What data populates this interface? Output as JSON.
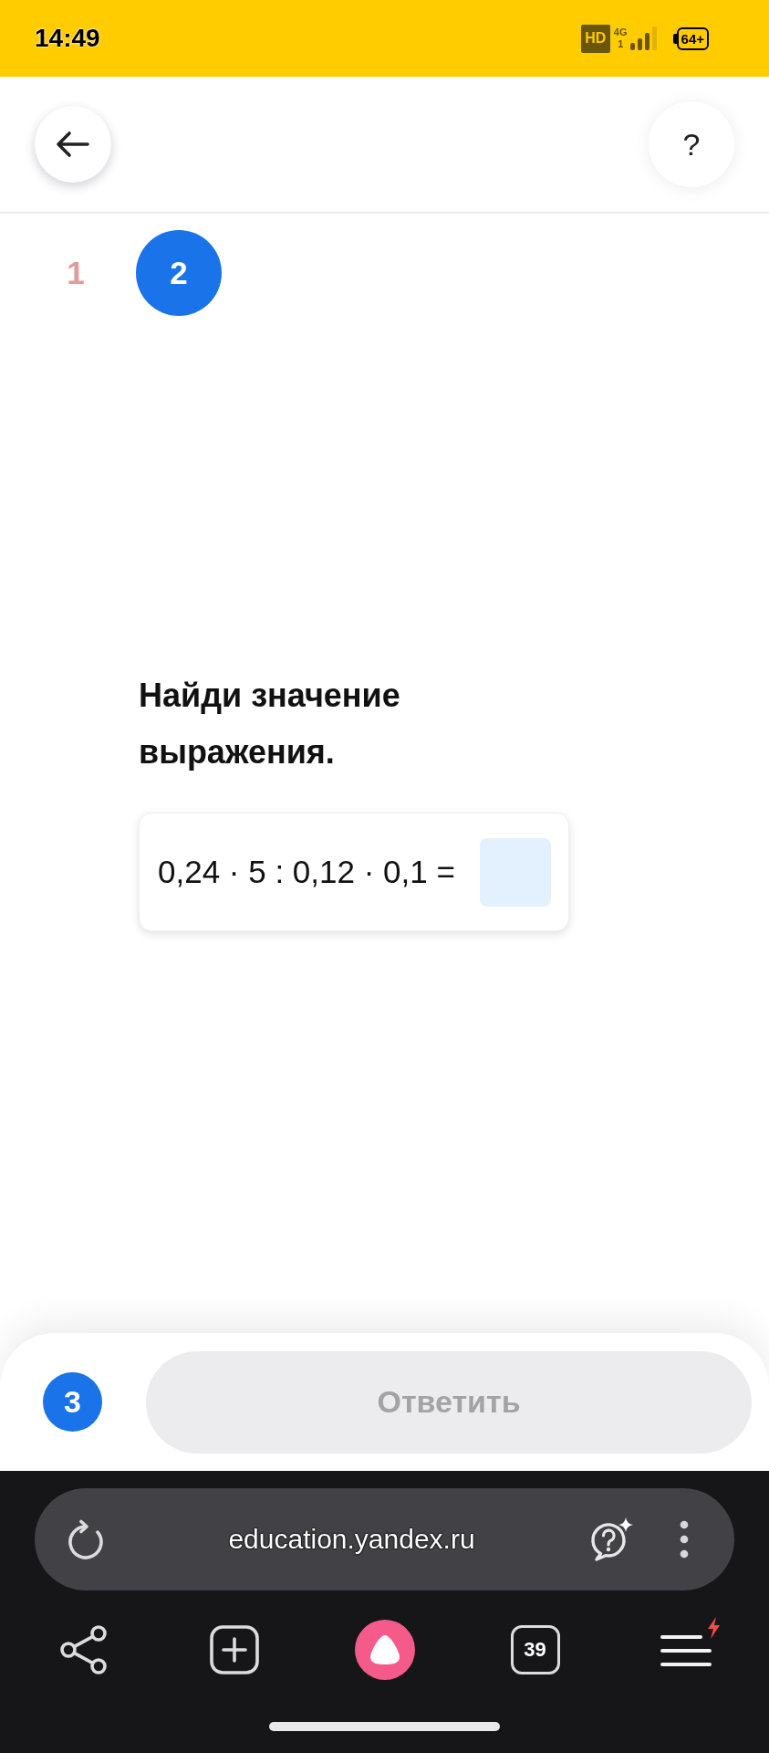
{
  "status_bar": {
    "time": "14:49",
    "hd_badge": "HD",
    "network": "4G",
    "sim": "1",
    "battery": "64+"
  },
  "header": {
    "help_button": "?"
  },
  "steps": [
    {
      "label": "1",
      "selected": false,
      "color": "#e59a9a"
    },
    {
      "label": "2",
      "selected": true,
      "color": "#1a73e8"
    }
  ],
  "task": {
    "prompt": "Найди значение выражения.",
    "expression": "0,24 · 5 : 0,12 · 0,1 ="
  },
  "bottom_bar": {
    "counter": "3",
    "answer_button": {
      "label": "Ответить",
      "disabled": true
    }
  },
  "browser": {
    "url": "education.yandex.ru",
    "tab_count": "39"
  }
}
